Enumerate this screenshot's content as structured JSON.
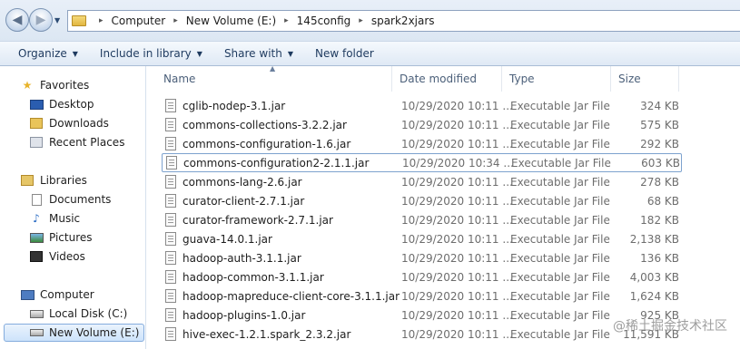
{
  "address": {
    "crumbs": [
      "Computer",
      "New Volume (E:)",
      "145config",
      "spark2xjars"
    ],
    "separator": "▸"
  },
  "toolbar": {
    "organize": "Organize",
    "include_in_library": "Include in library",
    "share_with": "Share with",
    "new_folder": "New folder"
  },
  "nav": {
    "favorites": "Favorites",
    "desktop": "Desktop",
    "downloads": "Downloads",
    "recent_places": "Recent Places",
    "libraries": "Libraries",
    "documents": "Documents",
    "music": "Music",
    "pictures": "Pictures",
    "videos": "Videos",
    "computer": "Computer",
    "local_disk": "Local Disk (C:)",
    "new_volume": "New Volume (E:)"
  },
  "columns": {
    "name": "Name",
    "date": "Date modified",
    "type": "Type",
    "size": "Size"
  },
  "files": [
    {
      "name": "cglib-nodep-3.1.jar",
      "date": "10/29/2020 10:11 ...",
      "type": "Executable Jar File",
      "size": "324 KB"
    },
    {
      "name": "commons-collections-3.2.2.jar",
      "date": "10/29/2020 10:11 ...",
      "type": "Executable Jar File",
      "size": "575 KB"
    },
    {
      "name": "commons-configuration-1.6.jar",
      "date": "10/29/2020 10:11 ...",
      "type": "Executable Jar File",
      "size": "292 KB"
    },
    {
      "name": "commons-configuration2-2.1.1.jar",
      "date": "10/29/2020 10:34 ...",
      "type": "Executable Jar File",
      "size": "603 KB"
    },
    {
      "name": "commons-lang-2.6.jar",
      "date": "10/29/2020 10:11 ...",
      "type": "Executable Jar File",
      "size": "278 KB"
    },
    {
      "name": "curator-client-2.7.1.jar",
      "date": "10/29/2020 10:11 ...",
      "type": "Executable Jar File",
      "size": "68 KB"
    },
    {
      "name": "curator-framework-2.7.1.jar",
      "date": "10/29/2020 10:11 ...",
      "type": "Executable Jar File",
      "size": "182 KB"
    },
    {
      "name": "guava-14.0.1.jar",
      "date": "10/29/2020 10:11 ...",
      "type": "Executable Jar File",
      "size": "2,138 KB"
    },
    {
      "name": "hadoop-auth-3.1.1.jar",
      "date": "10/29/2020 10:11 ...",
      "type": "Executable Jar File",
      "size": "136 KB"
    },
    {
      "name": "hadoop-common-3.1.1.jar",
      "date": "10/29/2020 10:11 ...",
      "type": "Executable Jar File",
      "size": "4,003 KB"
    },
    {
      "name": "hadoop-mapreduce-client-core-3.1.1.jar",
      "date": "10/29/2020 10:11 ...",
      "type": "Executable Jar File",
      "size": "1,624 KB"
    },
    {
      "name": "hadoop-plugins-1.0.jar",
      "date": "10/29/2020 10:11 ...",
      "type": "Executable Jar File",
      "size": "925 KB"
    },
    {
      "name": "hive-exec-1.2.1.spark_2.3.2.jar",
      "date": "10/29/2020 10:11 ...",
      "type": "Executable Jar File",
      "size": "11,591 KB"
    }
  ],
  "watermark": "@稀土掘金技术社区"
}
